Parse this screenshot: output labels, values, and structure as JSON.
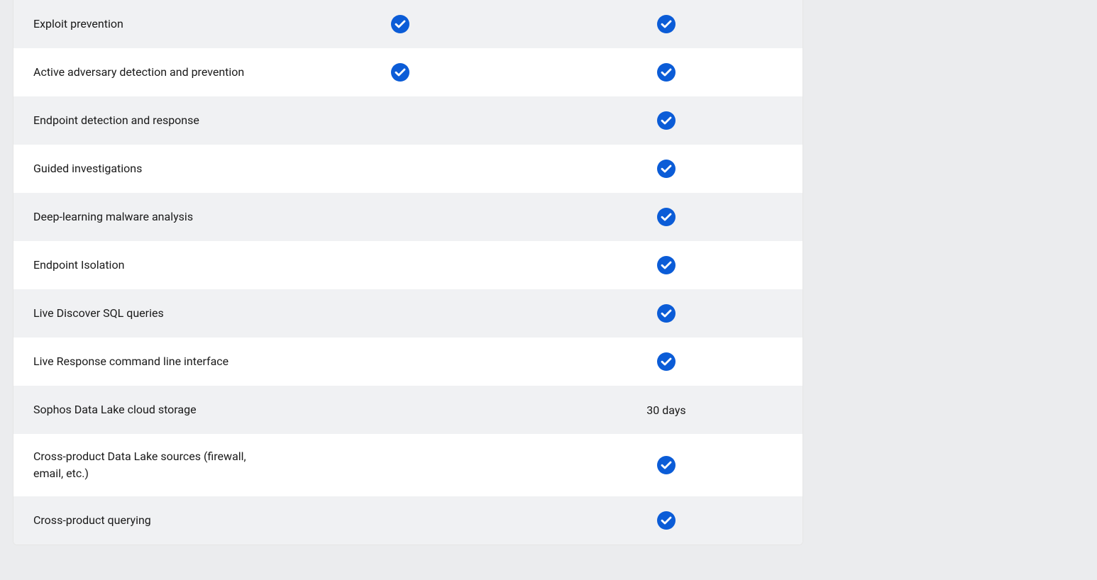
{
  "comparison_table": {
    "rows": [
      {
        "label": "Exploit prevention",
        "col1": "check",
        "col2": "check",
        "alt": true
      },
      {
        "label": "Active adversary detection and prevention",
        "col1": "check",
        "col2": "check",
        "alt": false
      },
      {
        "label": "Endpoint detection and response",
        "col1": "",
        "col2": "check",
        "alt": true
      },
      {
        "label": "Guided investigations",
        "col1": "",
        "col2": "check",
        "alt": false
      },
      {
        "label": "Deep-learning malware analysis",
        "col1": "",
        "col2": "check",
        "alt": true
      },
      {
        "label": "Endpoint Isolation",
        "col1": "",
        "col2": "check",
        "alt": false
      },
      {
        "label": "Live Discover SQL queries",
        "col1": "",
        "col2": "check",
        "alt": true
      },
      {
        "label": "Live Response command line interface",
        "col1": "",
        "col2": "check",
        "alt": false
      },
      {
        "label": "Sophos Data Lake cloud storage",
        "col1": "",
        "col2": "30 days",
        "alt": true
      },
      {
        "label": "Cross-product Data Lake sources (firewall, email, etc.)",
        "col1": "",
        "col2": "check",
        "alt": false
      },
      {
        "label": "Cross-product querying",
        "col1": "",
        "col2": "check",
        "alt": true
      }
    ]
  }
}
